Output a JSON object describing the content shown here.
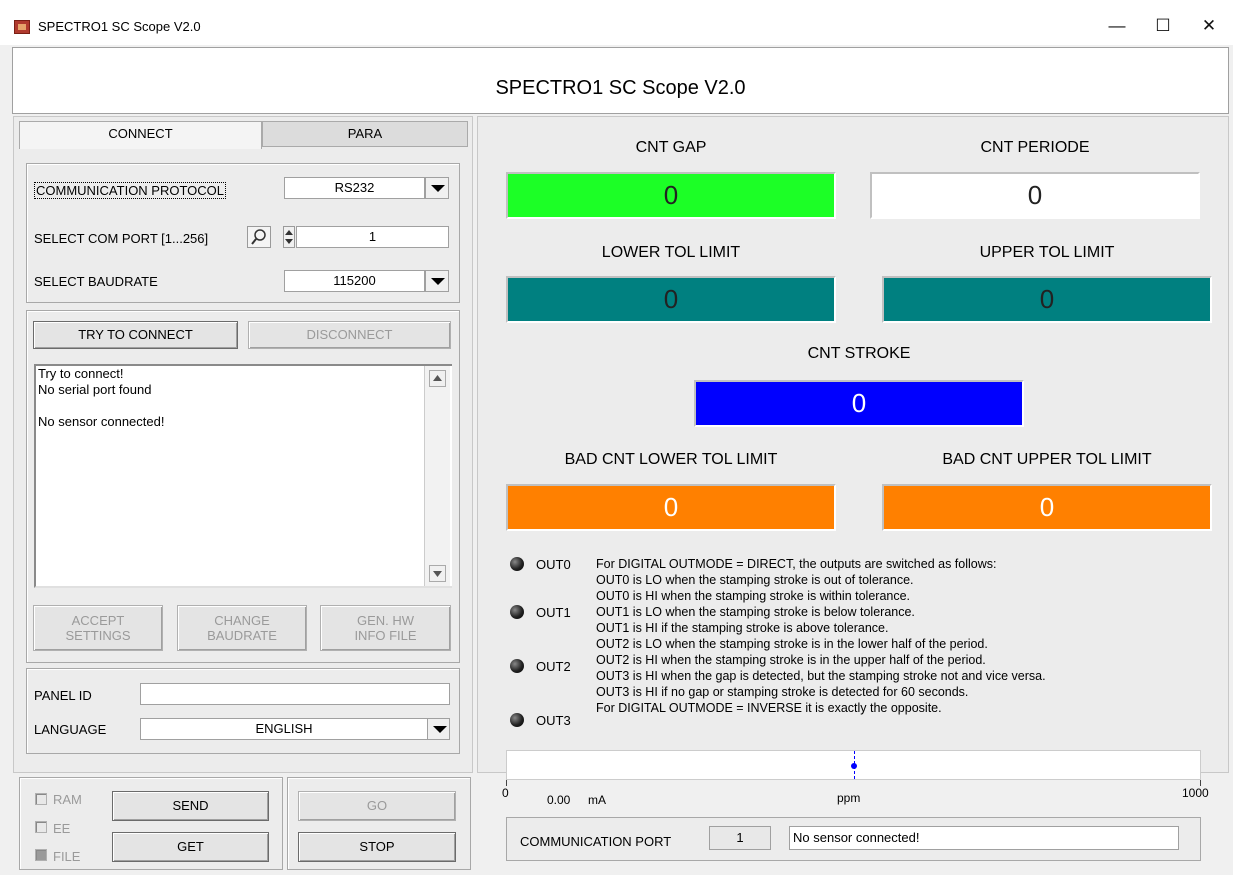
{
  "window": {
    "title": "SPECTRO1 SC Scope V2.0",
    "minimize": "—",
    "maximize": "☐",
    "close": "✕"
  },
  "header": {
    "title": "SPECTRO1 SC Scope V2.0"
  },
  "tabs": [
    {
      "label": "CONNECT"
    },
    {
      "label": "PARA"
    }
  ],
  "connect": {
    "protocol_label": "COMMUNICATION PROTOCOL",
    "protocol_value": "RS232",
    "comport_label": "SELECT COM PORT [1...256]",
    "comport_value": "1",
    "baud_label": "SELECT BAUDRATE",
    "baud_value": "115200",
    "try_connect": "TRY TO CONNECT",
    "disconnect": "DISCONNECT",
    "log": [
      "Try to connect!",
      "No serial port found",
      "",
      "No sensor connected!"
    ],
    "accept": [
      "ACCEPT",
      "SETTINGS"
    ],
    "change_baud": [
      "CHANGE",
      "BAUDRATE"
    ],
    "gen_hw": [
      "GEN. HW",
      "INFO FILE"
    ],
    "panel_id_label": "PANEL ID",
    "panel_id_value": "",
    "language_label": "LANGUAGE",
    "language_value": "ENGLISH"
  },
  "bottom": {
    "checkboxes": [
      "RAM",
      "EE",
      "FILE"
    ],
    "send": "SEND",
    "get": "GET",
    "go": "GO",
    "stop": "STOP"
  },
  "counters": {
    "cnt_gap": {
      "label": "CNT GAP",
      "value": "0",
      "color": "#1cff26"
    },
    "cnt_periode": {
      "label": "CNT PERIODE",
      "value": "0",
      "color": "#ffffff"
    },
    "lower_tol": {
      "label": "LOWER TOL LIMIT",
      "value": "0",
      "color": "#008080"
    },
    "upper_tol": {
      "label": "UPPER TOL LIMIT",
      "value": "0",
      "color": "#008080"
    },
    "cnt_stroke": {
      "label": "CNT STROKE",
      "value": "0",
      "color": "#0000ff"
    },
    "bad_lower": {
      "label": "BAD CNT LOWER TOL LIMIT",
      "value": "0",
      "color": "#ff8000"
    },
    "bad_upper": {
      "label": "BAD CNT UPPER TOL LIMIT",
      "value": "0",
      "color": "#ff8000"
    }
  },
  "outputs": [
    "OUT0",
    "OUT1",
    "OUT2",
    "OUT3"
  ],
  "description": [
    "For DIGITAL OUTMODE = DIRECT, the outputs are switched as follows:",
    "OUT0 is LO when the stamping stroke is out of tolerance.",
    "OUT0 is HI when the stamping stroke is within tolerance.",
    "OUT1 is LO when the stamping stroke is below tolerance.",
    "OUT1 is HI if the stamping stroke is above tolerance.",
    "OUT2 is LO when the stamping stroke is in the lower half of the period.",
    "OUT2 is HI when the stamping stroke is in the upper half of the period.",
    "OUT3 is HI when the gap is detected, but the stamping stroke not and vice versa.",
    "OUT3 is HI if no gap or stamping stroke is detected for 60 seconds.",
    "For DIGITAL OUTMODE = INVERSE it is exactly the opposite."
  ],
  "scale": {
    "min": "0",
    "max": "1000",
    "unit": "ppm",
    "value_text": "0.00",
    "value_unit": "mA",
    "marker_fraction": 0.5
  },
  "comm": {
    "label": "COMMUNICATION PORT",
    "port": "1",
    "status": "No sensor connected!"
  }
}
